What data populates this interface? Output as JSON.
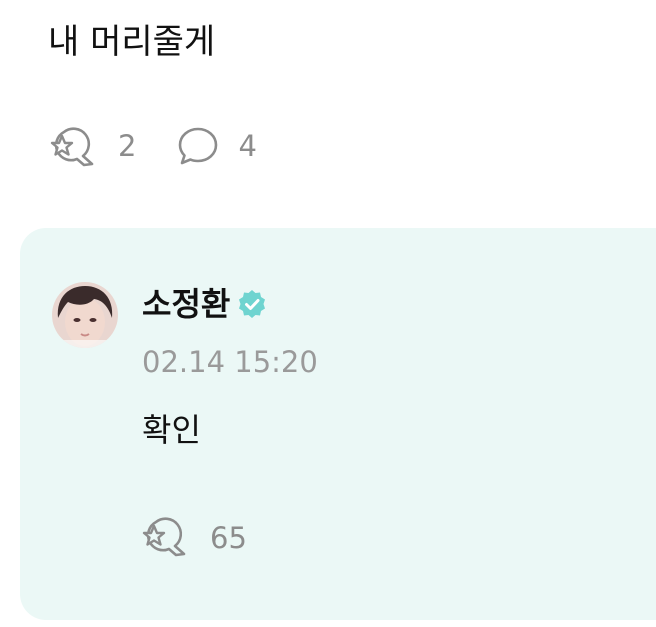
{
  "post": {
    "text": "내 머리줄게",
    "reaction_icon": "star-bubble-icon",
    "reaction_count": "2",
    "comment_icon": "speech-bubble-icon",
    "comment_count": "4"
  },
  "reply": {
    "author_name": "소정환",
    "verified_icon": "verified-badge-icon",
    "timestamp": "02.14 15:20",
    "text": "확인",
    "reaction_icon": "star-bubble-icon",
    "reaction_count": "65"
  },
  "colors": {
    "card_background": "#ebf8f6",
    "verified_badge": "#6fd4d0",
    "muted_text": "#9a9a9a",
    "icon_gray": "#8c8c8c"
  }
}
